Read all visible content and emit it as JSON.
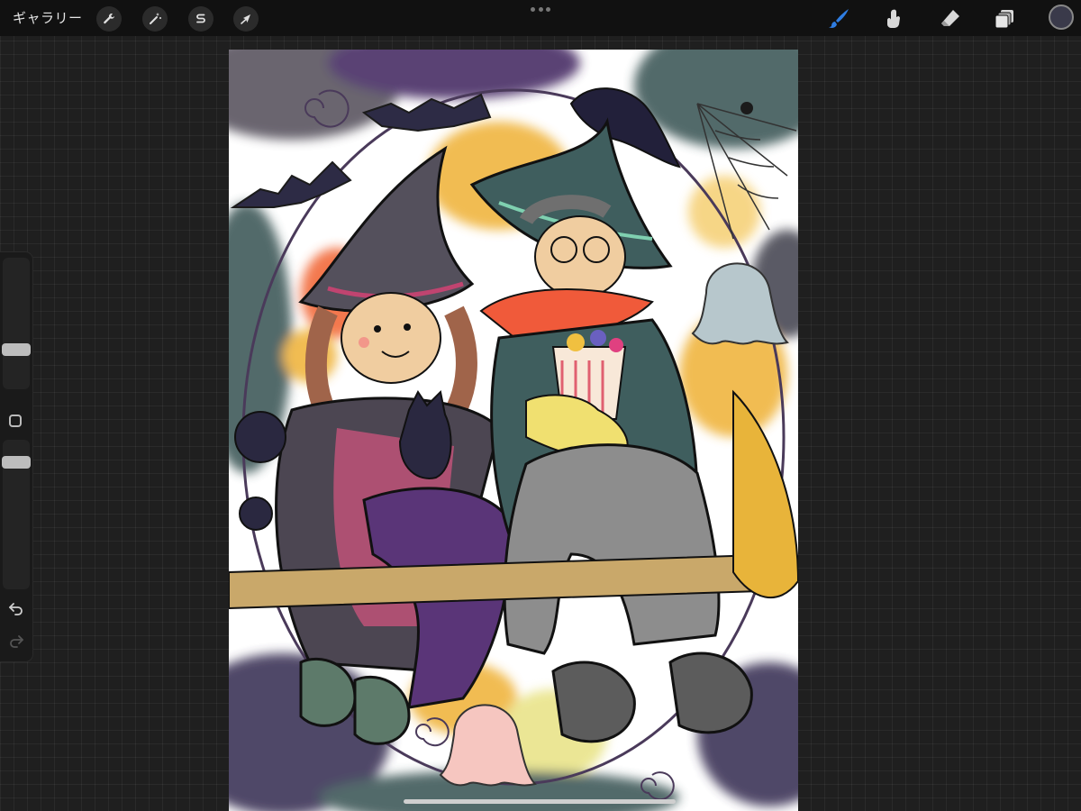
{
  "toolbar": {
    "gallery_label": "ギャラリー",
    "left_tools": [
      {
        "name": "actions",
        "icon": "wrench-icon"
      },
      {
        "name": "adjustments",
        "icon": "magic-wand-icon"
      },
      {
        "name": "selection",
        "icon": "selection-s-icon"
      },
      {
        "name": "transform",
        "icon": "arrow-cursor-icon"
      }
    ],
    "right_tools": [
      {
        "name": "brush",
        "icon": "brush-icon",
        "active": true
      },
      {
        "name": "smudge",
        "icon": "smudge-icon",
        "active": false
      },
      {
        "name": "eraser",
        "icon": "eraser-icon",
        "active": false
      },
      {
        "name": "layers",
        "icon": "layers-icon",
        "active": false
      }
    ],
    "active_color": "#2f7de1",
    "current_color": "#3a3a4a"
  },
  "sidebar": {
    "brush_size_level": 0.28,
    "opacity_level": 0.88,
    "undo_icon": "undo-icon",
    "redo_icon": "redo-icon"
  },
  "canvas": {
    "artwork": "halloween-witches-illustration"
  }
}
